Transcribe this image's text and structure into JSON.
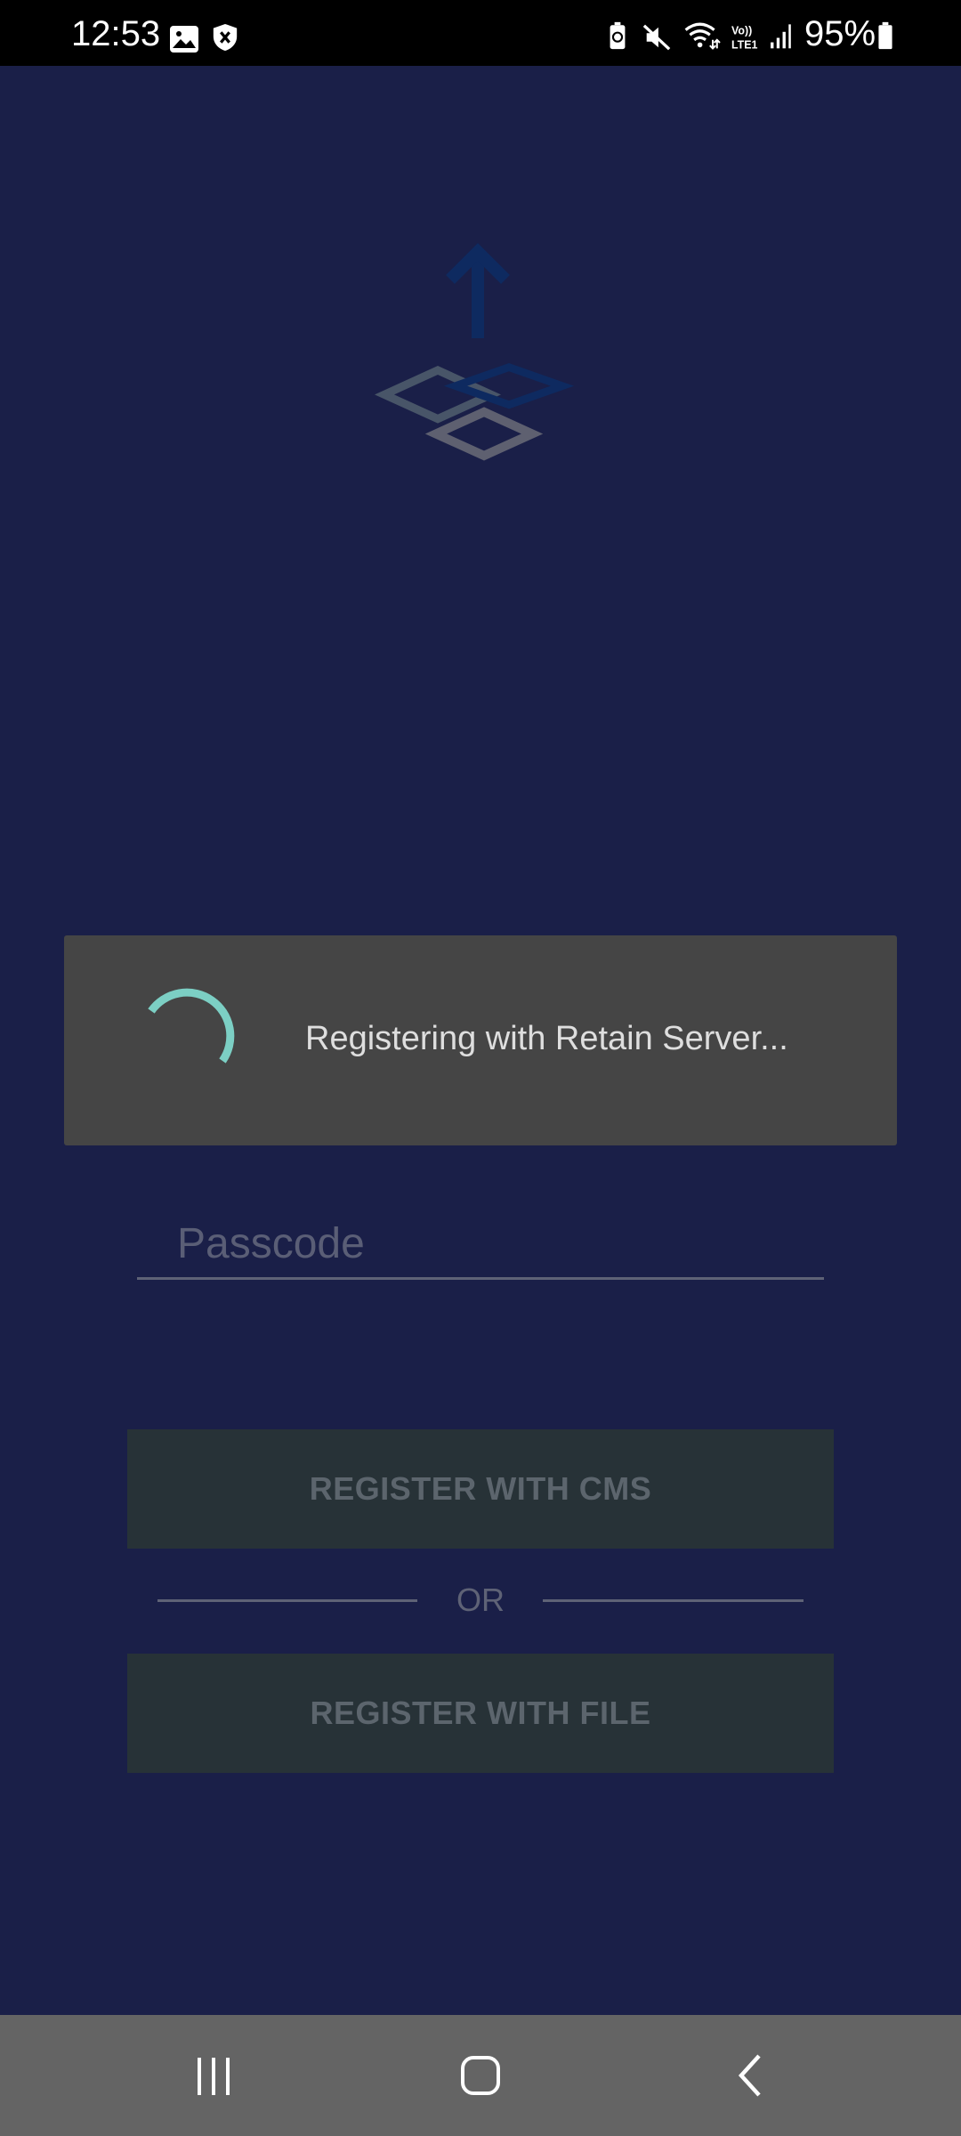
{
  "status_bar": {
    "time": "12:53",
    "battery_percent": "95%",
    "icons": [
      "gallery-icon",
      "shield-icon",
      "battery-saver-icon",
      "mute-icon",
      "wifi-icon",
      "volte-icon",
      "signal-icon",
      "battery-icon"
    ]
  },
  "app": {
    "logo": "retain-logo-icon"
  },
  "loading_dialog": {
    "message": "Registering with Retain Server...",
    "spinner_color": "#7ccfc4"
  },
  "passcode": {
    "placeholder": "Passcode",
    "value": ""
  },
  "actions": {
    "register_cms_label": "REGISTER WITH CMS",
    "or_label": "OR",
    "register_file_label": "REGISTER WITH FILE"
  },
  "nav_bar": {
    "buttons": [
      "recents-icon",
      "home-icon",
      "back-icon"
    ]
  },
  "colors": {
    "background": "#1a1f48",
    "dialog": "#454545",
    "button": "#273237",
    "navbar": "#646464"
  }
}
